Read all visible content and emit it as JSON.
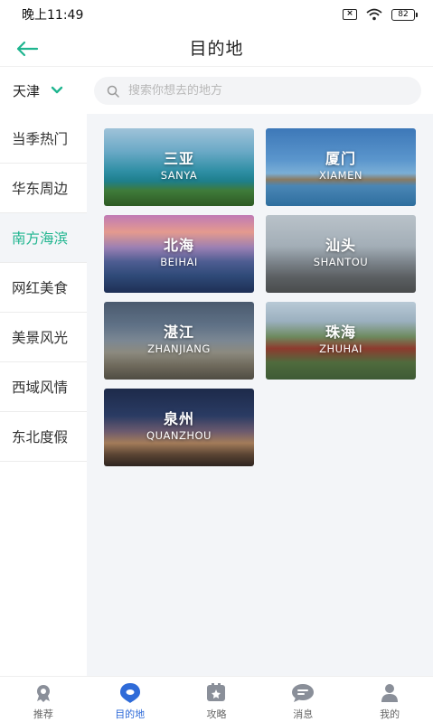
{
  "status_bar": {
    "time": "晚上11:49",
    "battery": "82"
  },
  "header": {
    "title": "目的地"
  },
  "city": {
    "name": "天津"
  },
  "search": {
    "placeholder": "搜索你想去的地方"
  },
  "sidebar": {
    "items": [
      {
        "label": "当季热门",
        "active": false
      },
      {
        "label": "华东周边",
        "active": false
      },
      {
        "label": "南方海滨",
        "active": true
      },
      {
        "label": "网红美食",
        "active": false
      },
      {
        "label": "美景风光",
        "active": false
      },
      {
        "label": "西域风情",
        "active": false
      },
      {
        "label": "东北度假",
        "active": false
      }
    ]
  },
  "destinations": [
    {
      "cn": "三亚",
      "en": "SANYA"
    },
    {
      "cn": "厦门",
      "en": "XIAMEN"
    },
    {
      "cn": "北海",
      "en": "BEIHAI"
    },
    {
      "cn": "汕头",
      "en": "SHANTOU"
    },
    {
      "cn": "湛江",
      "en": "ZHANJIANG"
    },
    {
      "cn": "珠海",
      "en": "ZHUHAI"
    },
    {
      "cn": "泉州",
      "en": "QUANZHOU"
    }
  ],
  "bottom_nav": [
    {
      "label": "推荐",
      "icon": "recommend-icon",
      "active": false
    },
    {
      "label": "目的地",
      "icon": "location-pin-icon",
      "active": true
    },
    {
      "label": "攻略",
      "icon": "guide-book-icon",
      "active": false
    },
    {
      "label": "消息",
      "icon": "message-bubble-icon",
      "active": false
    },
    {
      "label": "我的",
      "icon": "profile-icon",
      "active": false
    }
  ],
  "colors": {
    "accent_green": "#1fb58f",
    "accent_blue": "#2f6bd8"
  }
}
